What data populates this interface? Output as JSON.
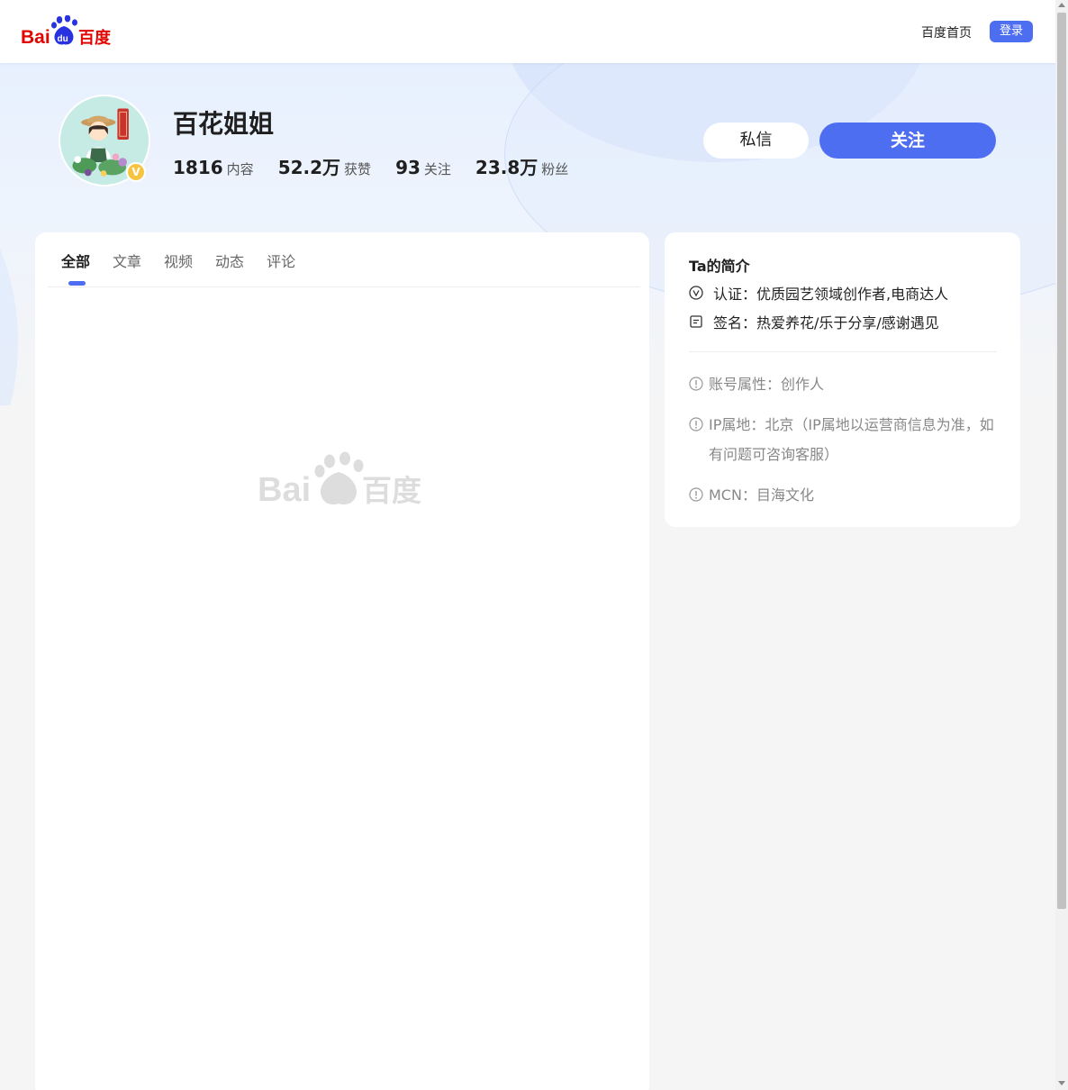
{
  "header": {
    "logo_text": "Bai百度",
    "home_link": "百度首页",
    "login_button": "登录"
  },
  "profile": {
    "name": "百花姐姐",
    "badge": "V",
    "stats": [
      {
        "value": "1816",
        "label": "内容"
      },
      {
        "value": "52.2万",
        "label": "获赞"
      },
      {
        "value": "93",
        "label": "关注"
      },
      {
        "value": "23.8万",
        "label": "粉丝"
      }
    ],
    "message_button": "私信",
    "follow_button": "关注"
  },
  "tabs": [
    {
      "label": "全部",
      "active": true
    },
    {
      "label": "文章",
      "active": false
    },
    {
      "label": "视频",
      "active": false
    },
    {
      "label": "动态",
      "active": false
    },
    {
      "label": "评论",
      "active": false
    }
  ],
  "intro": {
    "title": "Ta的简介",
    "certification": "认证：优质园艺领域创作者,电商达人",
    "signature": "签名：热爱养花/乐于分享/感谢遇见",
    "account_type": "账号属性：创作人",
    "ip_location": "IP属地：北京（IP属地以运营商信息为准，如有问题可咨询客服）",
    "mcn": "MCN：目海文化"
  },
  "colors": {
    "accent": "#4e6ef2",
    "baidu_red": "#e10602",
    "baidu_blue": "#2932e1"
  }
}
